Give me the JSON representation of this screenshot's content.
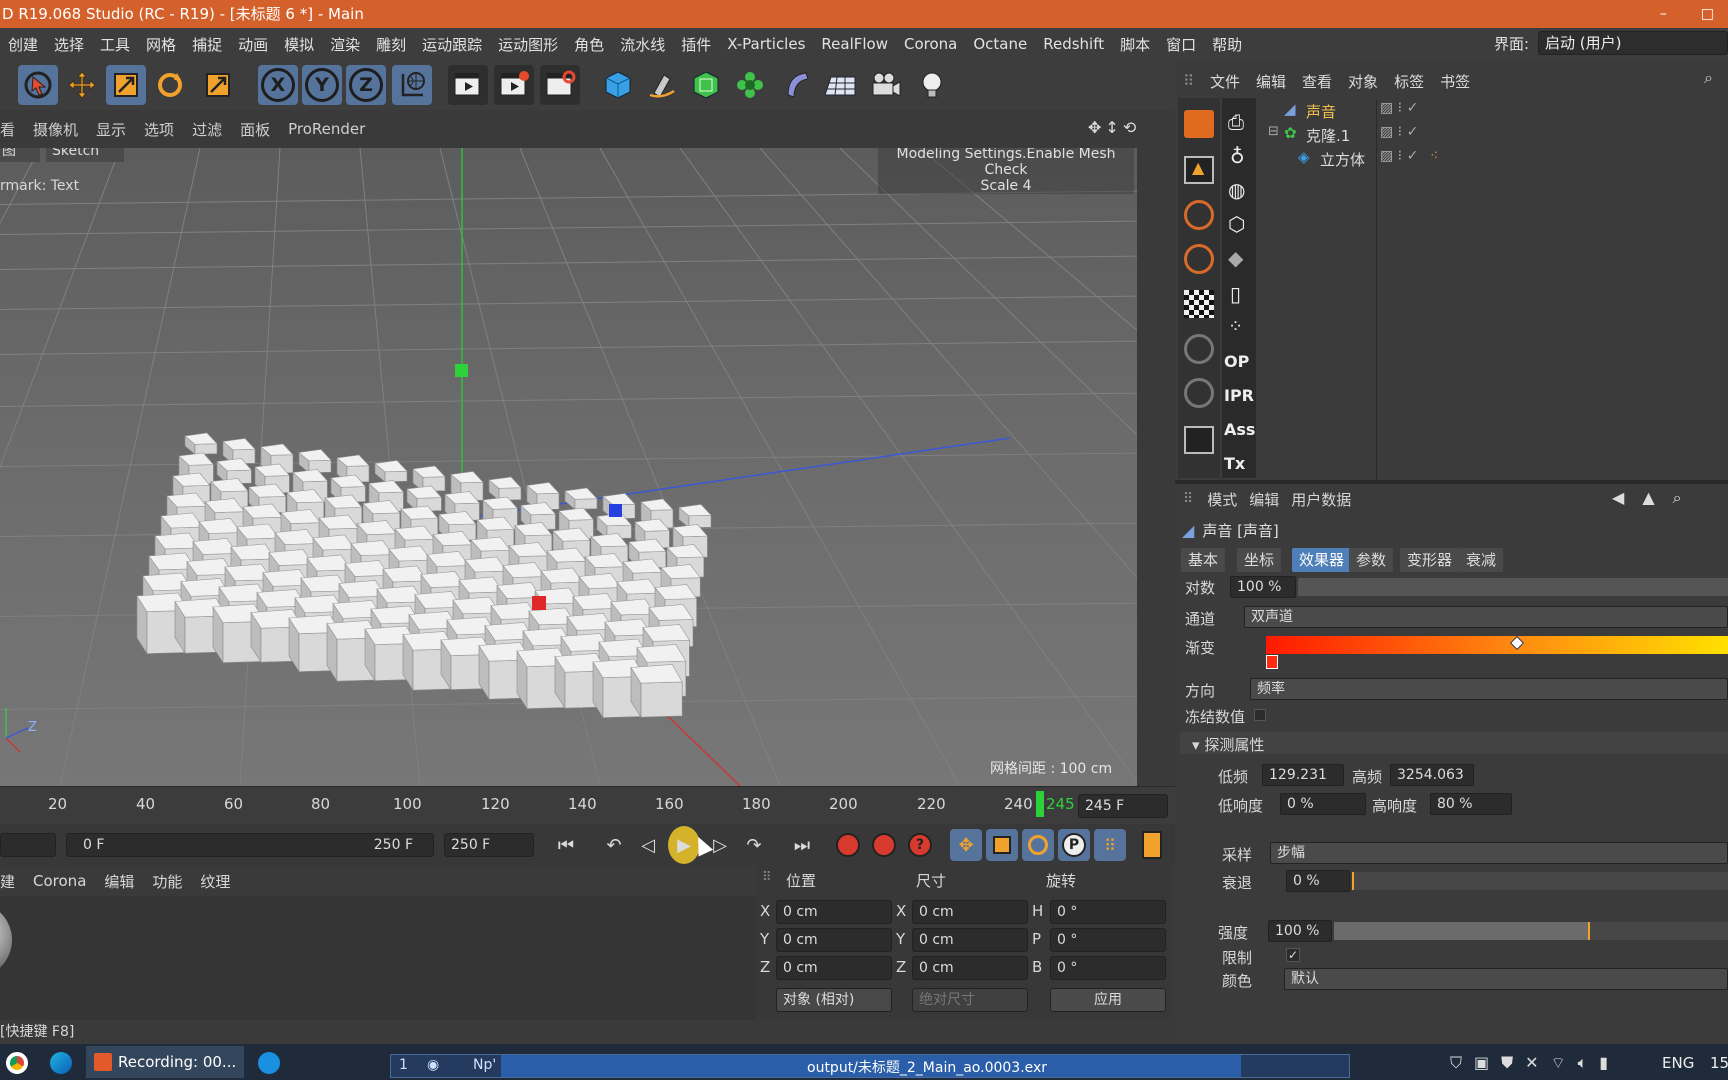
{
  "window": {
    "title": "D R19.068 Studio (RC - R19) - [未标题 6 *] - Main",
    "minimize": "–",
    "maximize": "□"
  },
  "menubar": [
    "创建",
    "选择",
    "工具",
    "网格",
    "捕捉",
    "动画",
    "模拟",
    "渲染",
    "雕刻",
    "运动跟踪",
    "运动图形",
    "角色",
    "流水线",
    "插件",
    "X-Particles",
    "RealFlow",
    "Corona",
    "Octane",
    "Redshift",
    "脚本",
    "窗口",
    "帮助"
  ],
  "layout": {
    "label": "界面:",
    "value": "启动 (用户)"
  },
  "toolbar": {
    "x": "X",
    "y": "Y",
    "z": "Z"
  },
  "viewport": {
    "menu": [
      "看",
      "摄像机",
      "显示",
      "选项",
      "过滤",
      "面板",
      "ProRender"
    ],
    "tab_left": "图",
    "tab_sketch": "Sketch",
    "watermark": "rmark: Text",
    "hud_line1": "Modeling Settings.Enable Mesh Check",
    "hud_line2": "Scale 4",
    "grid_spacing": "网格间距 : 100 cm",
    "axis_z": "Z"
  },
  "timeline": {
    "ticks": [
      "20",
      "40",
      "60",
      "80",
      "100",
      "120",
      "140",
      "160",
      "180",
      "200",
      "220",
      "240"
    ],
    "marker": "245",
    "end_frame": "245 F"
  },
  "playback": {
    "start_field": "0 F",
    "range_start": "0 F",
    "range_end": "250 F",
    "max_field": "250 F"
  },
  "material_menu": [
    "建",
    "Corona",
    "编辑",
    "功能",
    "纹理"
  ],
  "coordinates": {
    "headers": {
      "position": "位置",
      "size": "尺寸",
      "rotation": "旋转"
    },
    "rows": [
      {
        "axis": "X",
        "pos": "0 cm",
        "saxis": "X",
        "size": "0 cm",
        "raxis": "H",
        "rot": "0 °"
      },
      {
        "axis": "Y",
        "pos": "0 cm",
        "saxis": "Y",
        "size": "0 cm",
        "raxis": "P",
        "rot": "0 °"
      },
      {
        "axis": "Z",
        "pos": "0 cm",
        "saxis": "Z",
        "size": "0 cm",
        "raxis": "B",
        "rot": "0 °"
      }
    ],
    "mode": "对象 (相对)",
    "size_mode": "绝对尺寸",
    "apply": "应用"
  },
  "status": "[快捷键 F8]",
  "object_manager": {
    "menu": [
      "文件",
      "编辑",
      "查看",
      "对象",
      "标签",
      "书签"
    ],
    "side_labels": {
      "op": "OP",
      "ipr": "IPR",
      "ass": "Ass",
      "tx": "Tx"
    },
    "objects": [
      {
        "name": "声音",
        "color": "#f0c24a"
      },
      {
        "name": "克隆.1",
        "color": "#dcdcdc"
      },
      {
        "name": "立方体",
        "color": "#dcdcdc"
      }
    ]
  },
  "attributes": {
    "menu": [
      "模式",
      "编辑",
      "用户数据"
    ],
    "title": "声音 [声音]",
    "tabs": [
      {
        "label": "基本",
        "active": false
      },
      {
        "label": "坐标",
        "active": false
      },
      {
        "label": "效果器",
        "active": true
      },
      {
        "label": "参数",
        "active": false
      },
      {
        "label": "变形器",
        "active": false
      },
      {
        "label": "衰减",
        "active": false
      }
    ],
    "strength_label": "对数",
    "strength_value": "100 %",
    "channel_label": "通道",
    "channel_value": "双声道",
    "gradient_label": "渐变",
    "direction_label": "方向",
    "direction_value": "频率",
    "freeze_label": "冻结数值",
    "section": "探测属性",
    "low_freq_label": "低频",
    "low_freq_value": "129.231",
    "high_freq_label": "高频",
    "high_freq_value": "3254.063",
    "low_vol_label": "低响度",
    "low_vol_value": "0 %",
    "high_vol_label": "高响度",
    "high_vol_value": "80 %",
    "sample_label": "采样",
    "sample_value": "步幅",
    "decay_label": "衰退",
    "decay_value": "0 %",
    "intensity_label": "强度",
    "intensity_value": "100 %",
    "clamp_label": "限制",
    "color_label": "颜色",
    "color_value": "默认"
  },
  "taskbar": {
    "recording": "Recording: 00...",
    "render_index": "1",
    "render_label": "Np'",
    "render_file": "output/未标题_2_Main_ao.0003.exr",
    "lang": "ENG",
    "clock": "15"
  }
}
